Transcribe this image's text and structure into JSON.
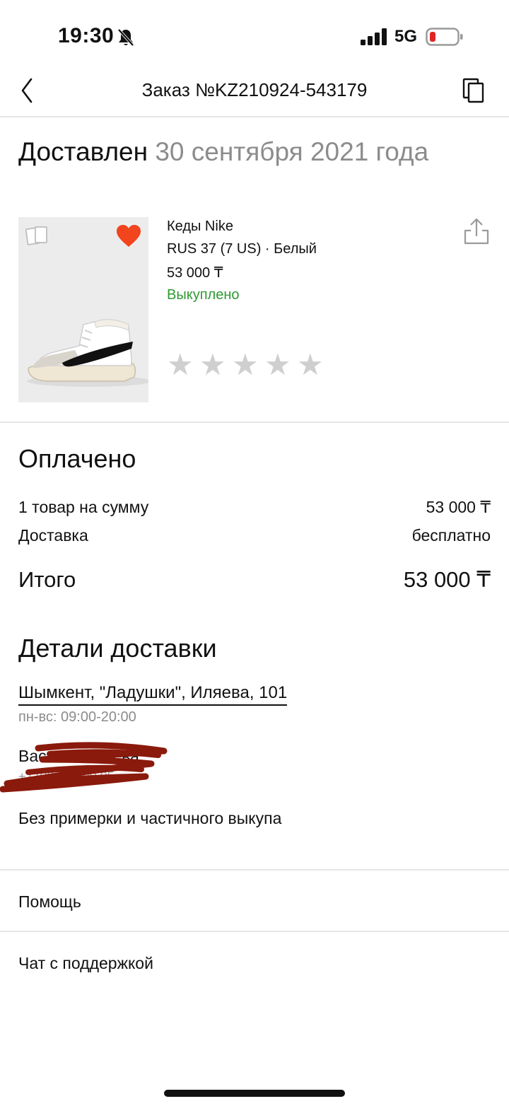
{
  "status_bar": {
    "time": "19:30",
    "network": "5G",
    "icons": [
      "bell-slash-icon",
      "signal-icon",
      "battery-low-icon"
    ],
    "battery_color": "#e02424"
  },
  "header": {
    "title": "Заказ №KZ210924-543179",
    "back_icon": "chevron-left-icon",
    "copy_icon": "copy-icon"
  },
  "order": {
    "status": "Доставлен",
    "status_date": "30 сентября 2021 года"
  },
  "product": {
    "name": "Кеды Nike",
    "variant": "RUS 37 (7 US) · Белый",
    "price": "53 000 ₸",
    "state": "Выкуплено",
    "state_color": "#2e9a31",
    "favorite_color": "#f2441d",
    "rating": 0,
    "rating_max": 5,
    "stars": [
      "★",
      "★",
      "★",
      "★",
      "★"
    ]
  },
  "payment": {
    "title": "Оплачено",
    "items_label": "1 товар на сумму",
    "items_value": "53 000 ₸",
    "delivery_label": "Доставка",
    "delivery_value": "бесплатно",
    "total_label": "Итого",
    "total_value": "53 000 ₸"
  },
  "delivery": {
    "title": "Детали доставки",
    "address": "Шымкент, \"Ладушки\", Иляева, 101",
    "hours": "пн-вс: 09:00-20:00",
    "note": "Без примерки и частичного выкупа"
  },
  "menu": {
    "help": "Помощь",
    "chat": "Чат с поддержкой"
  }
}
